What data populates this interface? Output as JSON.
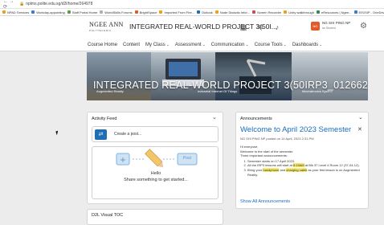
{
  "browser": {
    "url": "nplms.polite.edu.sg/d2l/home/264978",
    "bookmarks": [
      "NPAD Services",
      "Workday-appointing",
      "Staff Portal Home",
      "WorldSkills Forums",
      "BrightSpace",
      "Imported From Fire...",
      "Outlook",
      "Node Didactic Infor...",
      "Screen Recorder",
      "Unity walkthrough",
      "eResources | Ngee...",
      "EIS/SIP - OneDrive"
    ],
    "bookmark_colors": [
      "#e8a317",
      "#3a7bd5",
      "#5a9e46",
      "#b0b0b0",
      "#e05a2a",
      "#e8a317",
      "#1f6fb5",
      "#e8a317",
      "#d14b4b",
      "#e8a317",
      "#2e8b57",
      "#3a7bd5"
    ]
  },
  "navbar": {
    "logo_line1": "NGEE ANN",
    "logo_line2": "POLYTECHNIC",
    "course_title": "INTEGRATED REAL-WORLD PROJECT 3(50I...",
    "icons": [
      "grid-icon",
      "chat-icon",
      "bell-icon"
    ],
    "user_initials": "NG",
    "user_name": "NG SHI PING NP",
    "user_role": "as Student"
  },
  "minibar": {
    "items": [
      "Course Home",
      "Content",
      "My Class",
      "Assessment",
      "Communication",
      "Course Tools",
      "Dashboards"
    ],
    "dropdown_items": [
      "My Class",
      "Assessment",
      "Communication",
      "Course Tools",
      "Dashboards"
    ]
  },
  "banner": {
    "title": "INTEGRATED REAL-WORLD PROJECT 3(50IRP3_012662)",
    "captions": [
      "Augmented Reality",
      "Industrial Internet Of Things",
      "Mechatronics System"
    ]
  },
  "activity_feed": {
    "title": "Activity Feed",
    "post_placeholder": "Create a post...",
    "post_button": "Post",
    "empty_title": "Hello",
    "empty_subtitle": "Share something to get started..."
  },
  "visual_toc": {
    "title": "D2L Visual TOC"
  },
  "announcements": {
    "header": "Announcements",
    "title": "Welcome to April 2023 Semester",
    "meta": "NG SHI PING NP posted on 14 April, 2023 2:31 PM",
    "greeting": "Hi everyone,",
    "intro": "Welcome to the start of the semester.",
    "lead": "Three important announcements:",
    "point1": "Semester starts on 17 April 2023.",
    "point2_pre": "All the IRP3 lessons will start at ",
    "point2_hl": "8:15AM",
    "point2_post": " at Blk 37 Level 4 Room 12 (37-04-12).",
    "point3_pre": "Bring your ",
    "point3_hl1": "handphone",
    "point3_mid": " and ",
    "point3_hl2": "charging cable",
    "point3_post": " as your first lesson is on Augmented Reality.",
    "link": "Show All Announcements"
  }
}
